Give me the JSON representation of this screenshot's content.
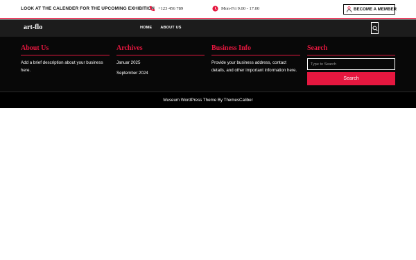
{
  "topbar": {
    "announcement": "LOOK AT THE CALENDER FOR THE UPCOMING EXHIBITION",
    "phone_icon": "phone-icon",
    "phone": "+123 456 789",
    "hours_icon": "clock-icon",
    "hours": "Mon-Fri 9.00 - 17.00",
    "member_icon": "user-icon",
    "member_button": "BECOME A MEMBER"
  },
  "nav": {
    "logo": "art-flo",
    "items": [
      {
        "label": "HOME"
      },
      {
        "label": "ABOUT US"
      }
    ],
    "search_icon": "search-icon"
  },
  "widgets": {
    "about": {
      "title": "About Us",
      "text": "Add a brief description about your business here."
    },
    "archives": {
      "title": "Archives",
      "items": [
        "Januar 2025",
        "September 2024"
      ]
    },
    "business": {
      "title": "Business Info",
      "text": "Provide your business address, contact details, and other important information here."
    },
    "search": {
      "title": "Search",
      "placeholder": "Type to Search",
      "button": "Search"
    }
  },
  "footer": {
    "credit": "Museum WordPress Theme By ThemesCaliber"
  },
  "colors": {
    "accent": "#e5173f",
    "dark": "#080808",
    "nav": "#1c1c1c"
  }
}
